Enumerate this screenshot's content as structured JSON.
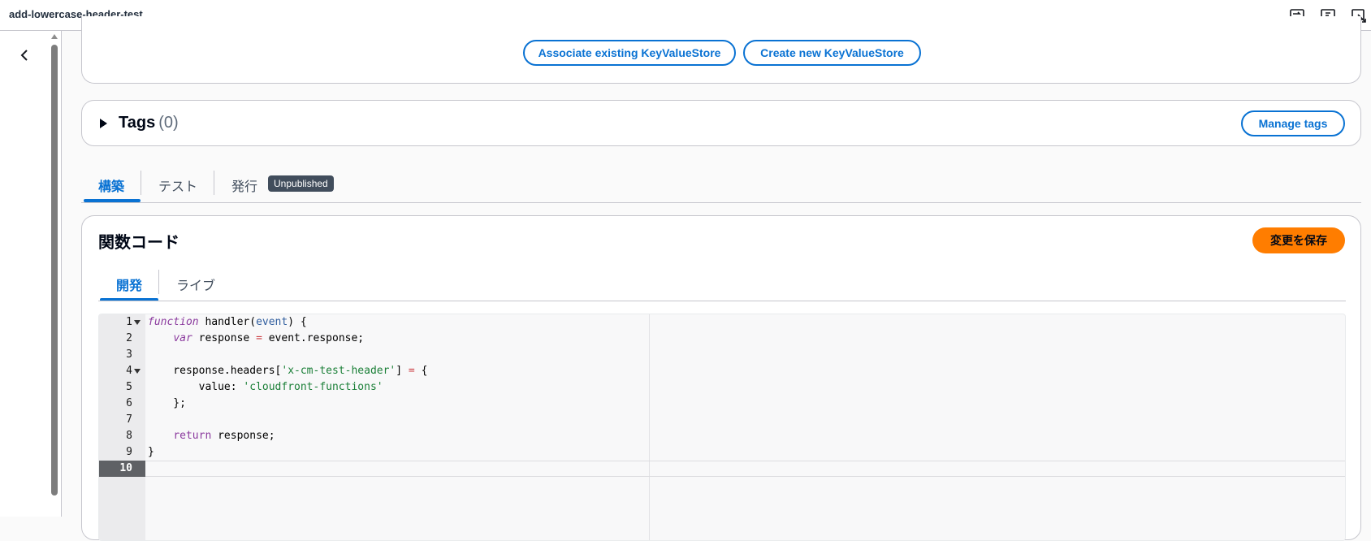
{
  "header": {
    "title": "add-lowercase-header-test",
    "icons": [
      "compare-icon",
      "feedback-icon",
      "fullscreen-icon"
    ]
  },
  "sidebar": {
    "collapse_icon": "chevron-left-icon"
  },
  "kvs": {
    "associate_label": "Associate existing KeyValueStore",
    "create_label": "Create new KeyValueStore"
  },
  "tags": {
    "title": "Tags",
    "count": "(0)",
    "manage_label": "Manage tags"
  },
  "main_tabs": [
    {
      "label": "構築",
      "active": true
    },
    {
      "label": "テスト",
      "active": false
    },
    {
      "label": "発行",
      "active": false,
      "badge": "Unpublished"
    }
  ],
  "function_code": {
    "title": "関数コード",
    "save_label": "変更を保存",
    "tabs": [
      {
        "label": "開発",
        "active": true
      },
      {
        "label": "ライブ",
        "active": false
      }
    ],
    "active_line": 10,
    "lines": [
      "function handler(event) {",
      "    var response = event.response;",
      "",
      "    response.headers['x-cm-test-header'] = {",
      "        value: 'cloudfront-functions'",
      "    };",
      "",
      "    return response;",
      "}",
      ""
    ]
  },
  "colors": {
    "accent": "#0972d3",
    "primary_button": "#ff7d00",
    "badge_bg": "#414d5c"
  }
}
